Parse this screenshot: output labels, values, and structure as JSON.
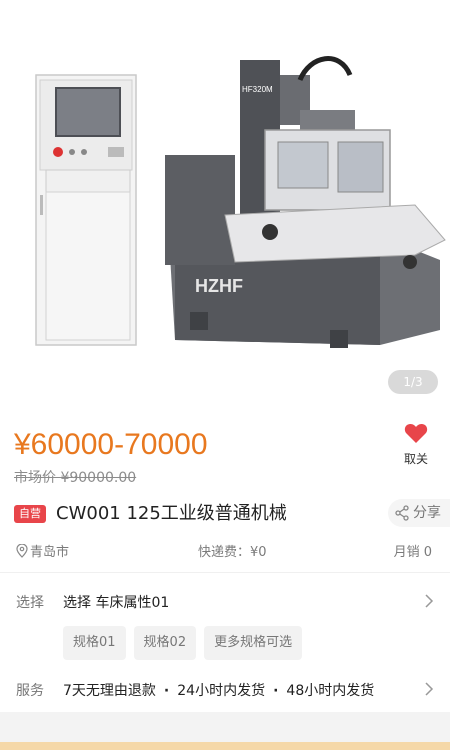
{
  "gallery": {
    "pager": "1/3",
    "brand_mark": "HZHF",
    "model_mark": "HF320M"
  },
  "price": {
    "range": "¥60000-70000",
    "market_label": "市场价",
    "market_price": "¥90000.00",
    "color": "#e8781f"
  },
  "favorite": {
    "label": "取关",
    "icon": "heart-icon",
    "color": "#e8454a"
  },
  "title": {
    "badge": "自营",
    "text": "CW001 125工业级普通机械",
    "share_label": "分享"
  },
  "info": {
    "location": "青岛市",
    "shipping": "快递费：¥0",
    "monthly_sales": "月销 0"
  },
  "select": {
    "label": "选择",
    "value": "选择  车床属性01",
    "options": [
      "规格01",
      "规格02",
      "更多规格可选"
    ]
  },
  "service": {
    "label": "服务",
    "items": [
      "7天无理由退款",
      "24小时内发货",
      "48小时内发货"
    ]
  }
}
